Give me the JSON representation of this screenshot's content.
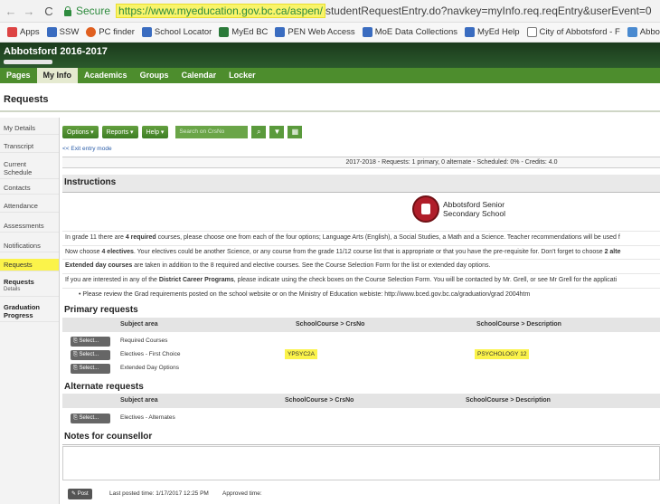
{
  "browser": {
    "back": "←",
    "forward": "→",
    "reload": "C",
    "secure_label": "Secure",
    "url_highlighted": "https://www.myeducation.gov.bc.ca/aspen/",
    "url_rest": "studentRequestEntry.do?navkey=myInfo.req.reqEntry&userEvent=0"
  },
  "bookmarks": [
    {
      "label": "Apps",
      "color": "#d44"
    },
    {
      "label": "SSW",
      "color": "#3a6cc0"
    },
    {
      "label": "PC finder",
      "color": "#e06020"
    },
    {
      "label": "School Locator",
      "color": "#3a6cc0"
    },
    {
      "label": "MyEd BC",
      "color": "#2b7a3a"
    },
    {
      "label": "PEN Web Access",
      "color": "#3a6cc0"
    },
    {
      "label": "MoE Data Collections",
      "color": "#3a6cc0"
    },
    {
      "label": "MyEd Help",
      "color": "#3a6cc0"
    },
    {
      "label": "City of Abbotsford - F",
      "color": "#777"
    },
    {
      "label": "Abbotsford Senic",
      "color": "#4a8ad0"
    }
  ],
  "header": {
    "school_year": "Abbotsford 2016-2017"
  },
  "tabs": [
    "Pages",
    "My Info",
    "Academics",
    "Groups",
    "Calendar",
    "Locker"
  ],
  "active_tab": "My Info",
  "page_title": "Requests",
  "sidebar": [
    {
      "label": "My Details"
    },
    {
      "label": "Transcript"
    },
    {
      "label": "Current Schedule"
    },
    {
      "label": "Contacts"
    },
    {
      "label": "Attendance"
    },
    {
      "label": "Assessments"
    },
    {
      "label": "Notifications"
    },
    {
      "label": "Requests"
    },
    {
      "label": "Requests",
      "sub": "Details"
    },
    {
      "label": "Graduation Progress"
    }
  ],
  "toolbar": {
    "options": "Options ▾",
    "reports": "Reports ▾",
    "help": "Help ▾",
    "search_placeholder": "Search on CrsNo",
    "search_icon": "⌕",
    "filter_icon": "▼",
    "grid_icon": "▦"
  },
  "exit_link": "<< Exit entry mode",
  "summary": "2017-2018 - Requests: 1 primary, 0 alternate - Scheduled: 0% - Credits: 4.0",
  "instructions": {
    "heading": "Instructions",
    "logo_line1": "Abbotsford Senior",
    "logo_line2": "Secondary School",
    "p1_a": "In grade 11 there are ",
    "p1_b": "4 required",
    "p1_c": " courses, please choose one from each of the four options; Language Arts (English), a Social Studies, a Math and a Science. Teacher recommendations will be used f",
    "p2_a": "Now choose ",
    "p2_b": "4 electives",
    "p2_c": ". Your electives could be another Science, or any course from the grade 11/12 course list that is appropriate or that you have the pre-requisite for. Don't forget to choose ",
    "p2_d": "2 alte",
    "p3_a": "Extended day courses",
    "p3_b": " are taken in addition to the 8 required and elective courses.  See the Course Selection Form for the list or extended day options.",
    "p4_a": "If you are interested in any of the ",
    "p4_b": "District Career Programs",
    "p4_c": ", please indicate using the check boxes on the Course Selection Form.  You will be contacted by Mr. Grell, or see Mr Grell for the applicati",
    "p5": "•  Please review the Grad requirements posted on the school website or on the Ministry of Education webiste: http://www.bced.gov.bc.ca/graduation/grad 2004htm"
  },
  "primary": {
    "heading": "Primary requests",
    "col_subject": "Subject area",
    "col_code": "SchoolCourse > CrsNo",
    "col_desc": "SchoolCourse > Description",
    "select_label": "Select...",
    "rows": [
      {
        "subject": "Required Courses",
        "code": "",
        "desc": ""
      },
      {
        "subject": "Electives - First Choice",
        "code": "YPSYC2A",
        "desc": "PSYCHOLOGY 12"
      },
      {
        "subject": "Extended Day Options",
        "code": "",
        "desc": ""
      }
    ]
  },
  "alternate": {
    "heading": "Alternate requests",
    "col_subject": "Subject area",
    "col_code": "SchoolCourse > CrsNo",
    "col_desc": "SchoolCourse > Description",
    "select_label": "Select...",
    "rows": [
      {
        "subject": "Electives - Alternates"
      }
    ]
  },
  "notes": {
    "heading": "Notes for counsellor"
  },
  "footer": {
    "post_label": "Post",
    "last_posted": "Last posted time: 1/17/2017 12:25 PM",
    "approved": "Approved time:"
  }
}
